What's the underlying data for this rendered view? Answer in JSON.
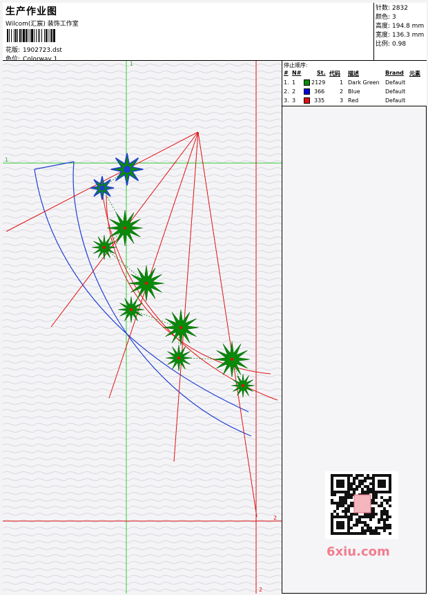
{
  "header": {
    "title": "生产作业图",
    "studio": "Wilcom(汇宸) 装饰工作室",
    "file_label": "花版:",
    "file_value": "1902723.dst",
    "colorway_label": "色位:",
    "colorway_value": "Colorway 1"
  },
  "stats": {
    "stitches_label": "针数:",
    "stitches_value": "2832",
    "colors_label": "颜色:",
    "colors_value": "3",
    "height_label": "高度:",
    "height_value": "194.8 mm",
    "width_label": "宽度:",
    "width_value": "136.3 mm",
    "scale_label": "比例:",
    "scale_value": "0.98"
  },
  "stop_sequence": {
    "title": "停止顺序:",
    "headers": [
      "#",
      "N#",
      "St.",
      "代码",
      "描述",
      "Brand",
      "元素"
    ],
    "rows": [
      {
        "num": "1.",
        "n": "1",
        "color": "#0a8a0a",
        "stitches": "2129",
        "code": "1",
        "desc": "Dark Green",
        "brand": "Default"
      },
      {
        "num": "2.",
        "n": "2",
        "color": "#0000dd",
        "stitches": "366",
        "code": "2",
        "desc": "Blue",
        "brand": "Default"
      },
      {
        "num": "3.",
        "n": "3",
        "color": "#e01010",
        "stitches": "335",
        "code": "3",
        "desc": "Red",
        "brand": "Default"
      }
    ]
  },
  "guides": {
    "top_marker_1": "1",
    "left_marker_1": "1",
    "right_marker_2": "2",
    "bottom_marker_2": "2"
  },
  "watermark": {
    "text": "6xiu.com"
  },
  "colors": {
    "guide_green": "#33cc33",
    "guide_red": "#dd1111",
    "thread_green": "#0a8a0a",
    "thread_blue": "#1f3fd0",
    "thread_red": "#e01010"
  }
}
